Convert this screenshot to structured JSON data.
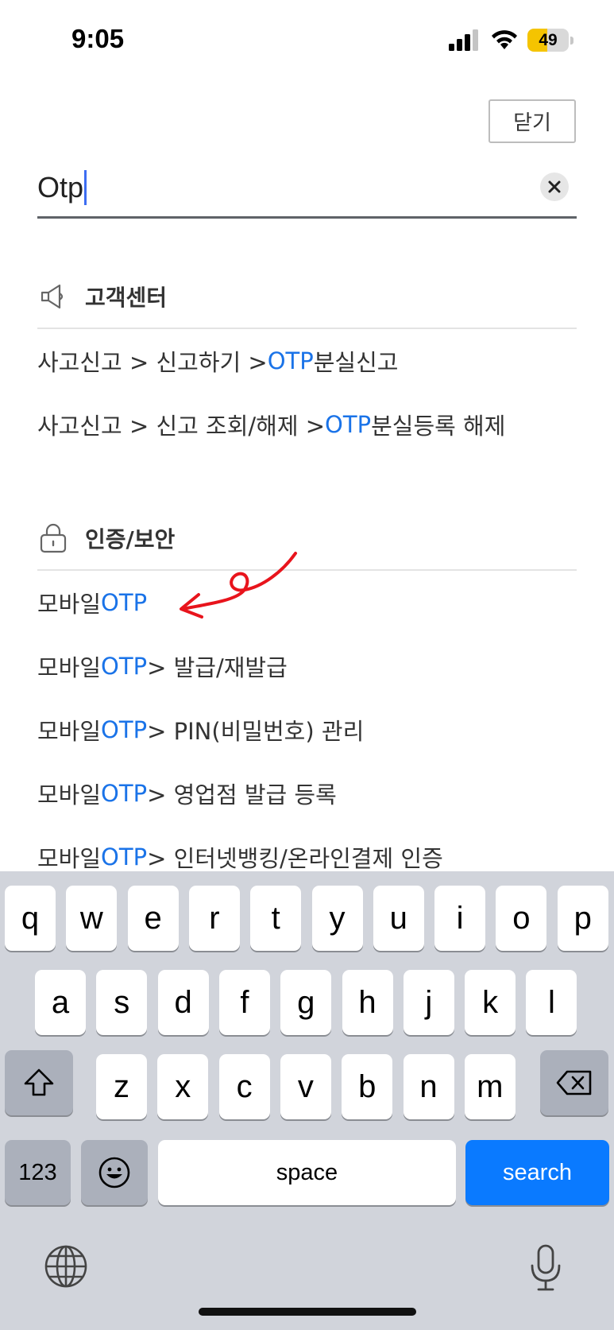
{
  "status_bar": {
    "time": "9:05",
    "battery_level": "49",
    "battery_fraction": 0.49
  },
  "header": {
    "close_label": "닫기"
  },
  "search": {
    "query": "Otp",
    "clear_icon": "close-icon"
  },
  "sections": [
    {
      "title": "고객센터",
      "icon": "megaphone-icon",
      "items": [
        {
          "pre": "사고신고 > 신고하기 > ",
          "highlight": "OTP",
          "post": " 분실신고"
        },
        {
          "pre": "사고신고 > 신고 조회/해제 > ",
          "highlight": "OTP",
          "post": " 분실등록 해제"
        }
      ]
    },
    {
      "title": "인증/보안",
      "icon": "lock-icon",
      "items": [
        {
          "pre": "모바일 ",
          "highlight": "OTP",
          "post": ""
        },
        {
          "pre": "모바일 ",
          "highlight": "OTP",
          "post": " > 발급/재발급"
        },
        {
          "pre": "모바일 ",
          "highlight": "OTP",
          "post": " > PIN(비밀번호) 관리"
        },
        {
          "pre": "모바일 ",
          "highlight": "OTP",
          "post": " > 영업점 발급 등록"
        },
        {
          "pre": "모바일 ",
          "highlight": "OTP",
          "post": " > 인터넷뱅킹/온라인결제 인증"
        }
      ]
    }
  ],
  "colors": {
    "highlight": "#1a73e8",
    "annotation": "#e8141c",
    "search_key": "#0a7aff"
  },
  "keyboard": {
    "row1": [
      "q",
      "w",
      "e",
      "r",
      "t",
      "y",
      "u",
      "i",
      "o",
      "p"
    ],
    "row2": [
      "a",
      "s",
      "d",
      "f",
      "g",
      "h",
      "j",
      "k",
      "l"
    ],
    "row3": [
      "z",
      "x",
      "c",
      "v",
      "b",
      "n",
      "m"
    ],
    "numbers_label": "123",
    "space_label": "space",
    "search_label": "search"
  }
}
